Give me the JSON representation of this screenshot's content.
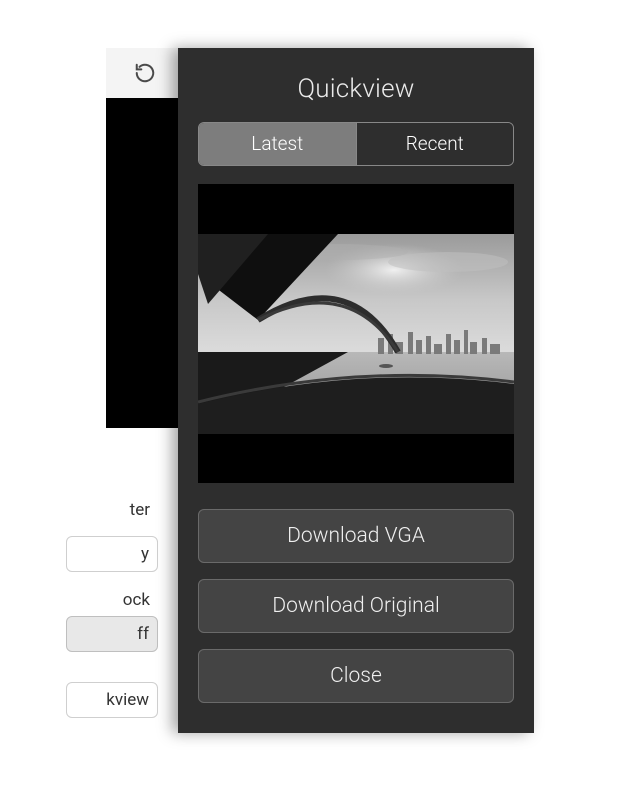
{
  "background": {
    "reload_icon": "refresh-icon",
    "labels": {
      "ter": "ter",
      "y": "y",
      "ock": "ock",
      "off": "ff",
      "kview": "kview"
    }
  },
  "quickview": {
    "title": "Quickview",
    "tabs": {
      "latest": "Latest",
      "recent": "Recent",
      "active": "latest"
    },
    "image_alt": "bridge-skyline-photo",
    "buttons": {
      "download_vga": "Download VGA",
      "download_original": "Download Original",
      "close": "Close"
    }
  }
}
